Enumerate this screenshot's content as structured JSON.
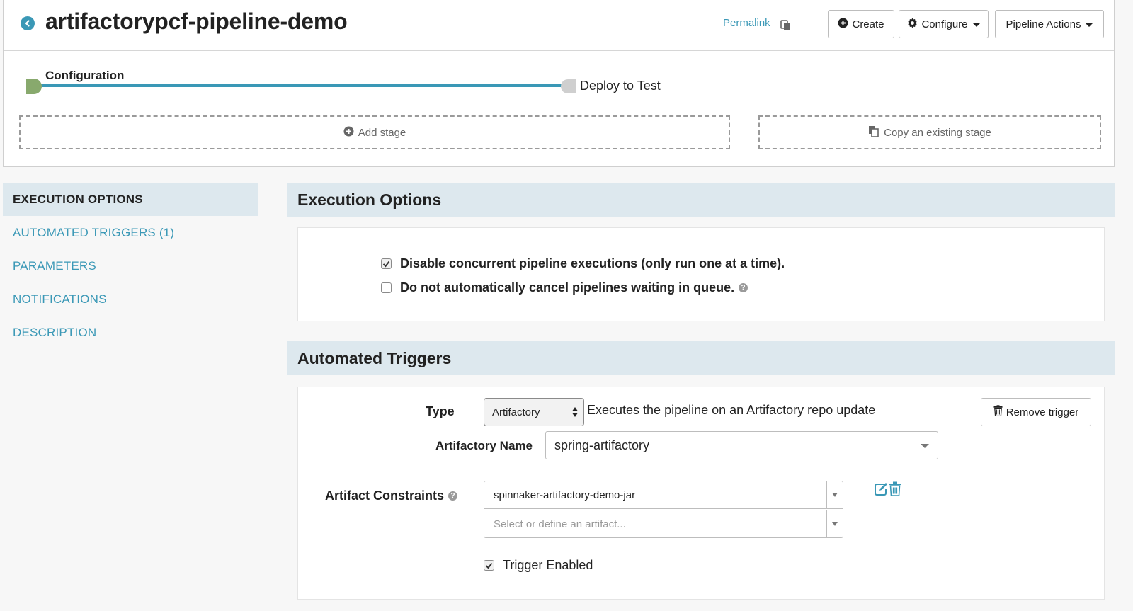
{
  "header": {
    "title": "artifactorypcf-pipeline-demo",
    "permalink_label": "Permalink",
    "buttons": {
      "create": "Create",
      "configure": "Configure",
      "pipeline_actions": "Pipeline Actions"
    }
  },
  "stages": {
    "items": [
      {
        "label": "Configuration",
        "color": "#88a96d"
      },
      {
        "label": "Deploy to Test",
        "color": "#cfcfcf"
      }
    ],
    "connector_color": "#3a98b6",
    "add_stage_label": "Add stage",
    "copy_stage_label": "Copy an existing stage"
  },
  "nav": {
    "items": [
      {
        "label": "EXECUTION OPTIONS",
        "active": true
      },
      {
        "label": "AUTOMATED TRIGGERS (1)",
        "active": false
      },
      {
        "label": "PARAMETERS",
        "active": false
      },
      {
        "label": "NOTIFICATIONS",
        "active": false
      },
      {
        "label": "DESCRIPTION",
        "active": false
      }
    ]
  },
  "execution_options": {
    "heading": "Execution Options",
    "options": [
      {
        "label": "Disable concurrent pipeline executions (only run one at a time).",
        "checked": true
      },
      {
        "label": "Do not automatically cancel pipelines waiting in queue.",
        "checked": false
      }
    ],
    "help_glyph": "?"
  },
  "automated_triggers": {
    "heading": "Automated Triggers",
    "type_label": "Type",
    "type_value": "Artifactory",
    "type_description": "Executes the pipeline on an Artifactory repo update",
    "remove_trigger_label": "Remove trigger",
    "artifactory_name_label": "Artifactory Name",
    "artifactory_name_value": "spring-artifactory",
    "artifact_constraints_label": "Artifact Constraints",
    "artifact_constraint_value": "spinnaker-artifactory-demo-jar",
    "artifact_placeholder": "Select or define an artifact...",
    "trigger_enabled_label": "Trigger Enabled",
    "trigger_enabled": true
  },
  "colors": {
    "accent": "#3a98b6",
    "section_header_bg": "#dde8ee"
  }
}
